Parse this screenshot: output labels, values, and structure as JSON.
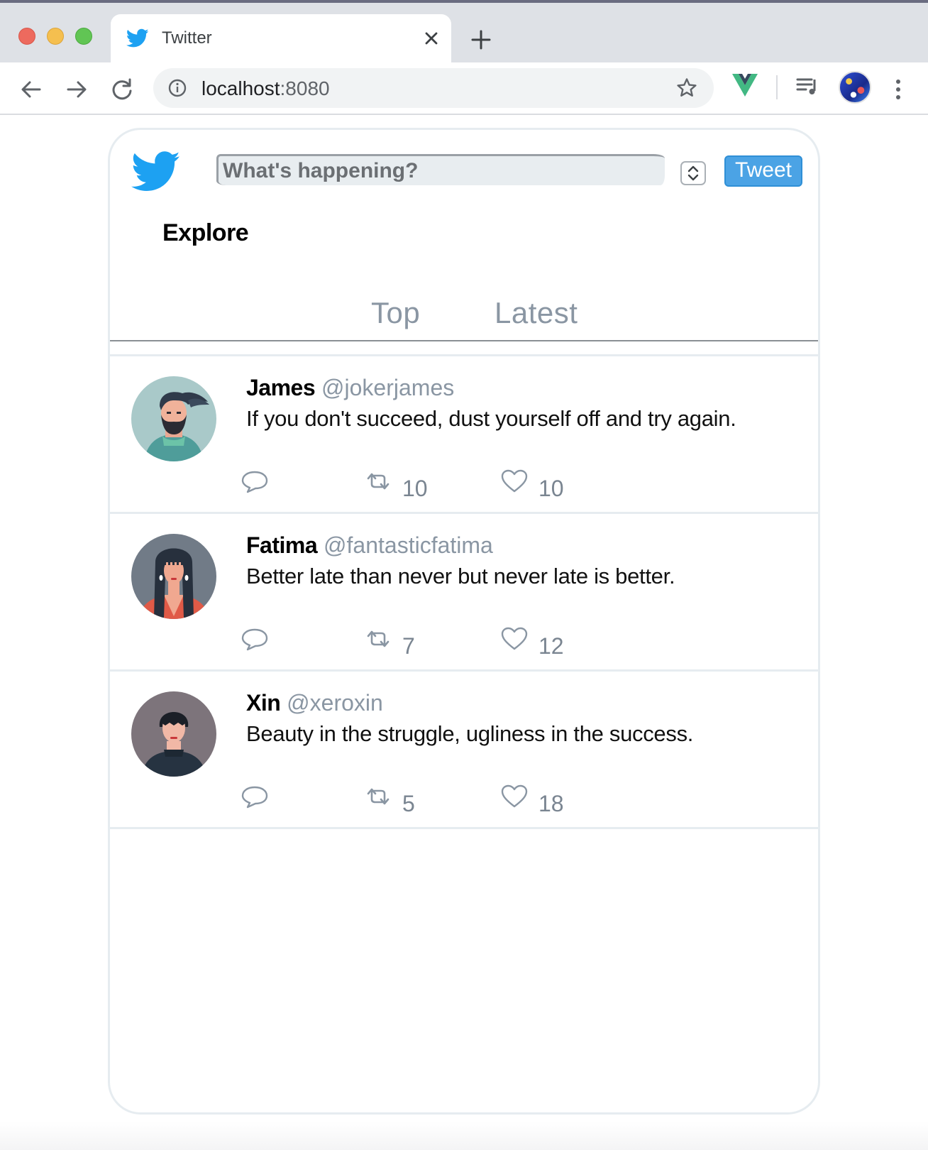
{
  "browser": {
    "tab_title": "Twitter",
    "url_host": "localhost",
    "url_port": ":8080"
  },
  "compose": {
    "placeholder": "What's happening?",
    "button_label": "Tweet"
  },
  "explore": {
    "title": "Explore",
    "tabs": [
      {
        "label": "Top"
      },
      {
        "label": "Latest"
      }
    ]
  },
  "tweets": [
    {
      "name": "James",
      "handle": "@jokerjames",
      "text": "If you don't succeed, dust yourself off and try again.",
      "retweets": "10",
      "likes": "10"
    },
    {
      "name": "Fatima",
      "handle": "@fantasticfatima",
      "text": "Better late than never but never late is better.",
      "retweets": "7",
      "likes": "12"
    },
    {
      "name": "Xin",
      "handle": "@xeroxin",
      "text": "Beauty in the struggle, ugliness in the success.",
      "retweets": "5",
      "likes": "18"
    }
  ],
  "colors": {
    "brand": "#1da1f2",
    "button": "#4ba3e5",
    "muted": "#8a96a3"
  },
  "icons": [
    "twitter-bird-icon",
    "close-icon",
    "plus-icon",
    "back-arrow-icon",
    "forward-arrow-icon",
    "reload-icon",
    "info-icon",
    "star-icon",
    "vue-devtools-icon",
    "media-queue-icon",
    "kebab-menu-icon",
    "reply-icon",
    "retweet-icon",
    "like-heart-icon"
  ]
}
